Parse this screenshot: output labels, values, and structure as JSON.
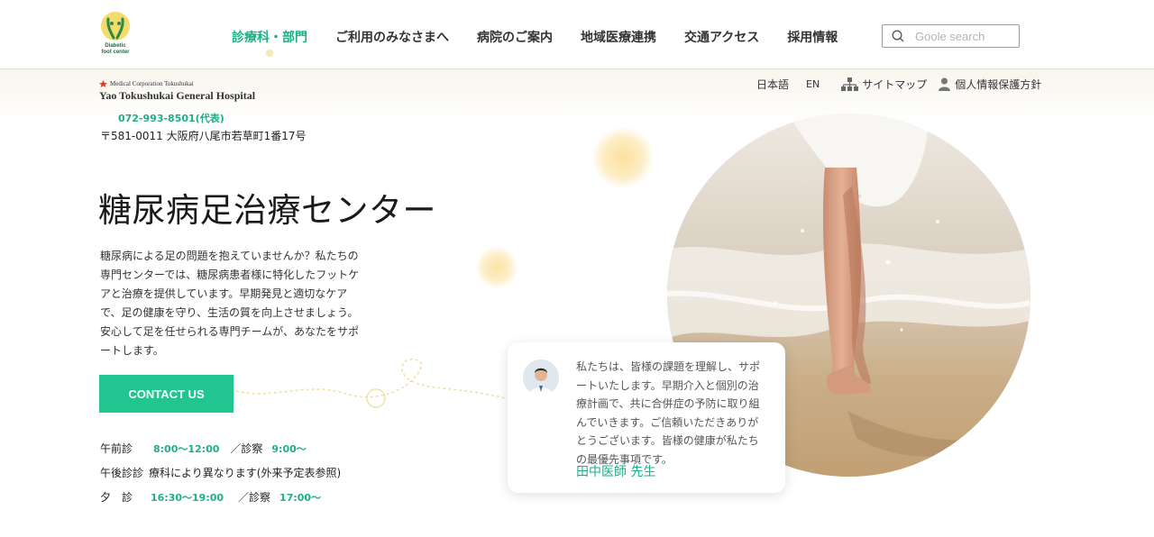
{
  "logo": {
    "text_line1": "Diabetic",
    "text_line2": "foot center"
  },
  "nav": {
    "items": [
      {
        "label": "診療科・部門",
        "active": true
      },
      {
        "label": "ご利用のみなさまへ",
        "active": false
      },
      {
        "label": "病院のご案内",
        "active": false
      },
      {
        "label": "地域医療連携",
        "active": false
      },
      {
        "label": "交通アクセス",
        "active": false
      },
      {
        "label": "採用情報",
        "active": false
      }
    ]
  },
  "search": {
    "placeholder": "Goole search",
    "icon": "search-icon"
  },
  "hospital": {
    "corp": "Medical Corporation Tokushukai",
    "name": "Yao Tokushukai  General Hospital",
    "phone": "072-993-8501(代表)",
    "address": "〒581-0011 大阪府八尾市若草町1番17号"
  },
  "utility": {
    "lang_ja": "日本語",
    "lang_en": "EN",
    "sitemap": "サイトマップ",
    "privacy": "個人情報保護方針"
  },
  "hero": {
    "title": "糖尿病足治療センター",
    "description": "糖尿病による足の問題を抱えていませんか？私たちの専門センターでは、糖尿病患者様に特化したフットケアと治療を提供しています。早期発見と適切なケアで、足の健康を守り、生活の質を向上させましょう。安心して足を任せられる専門チームが、あなたをサポートします。",
    "cta": "CONTACT US"
  },
  "hours": {
    "morning_label": "午前診",
    "morning_time": "8:00〜12:00",
    "morning_sep": "／診察",
    "morning_exam": "9:00〜",
    "afternoon_label": "午後診診",
    "afternoon_text": "療科により異なります(外来予定表参照)",
    "evening_label": "夕　診",
    "evening_time": "16:30〜19:00",
    "evening_sep": "／診察",
    "evening_exam": "17:00〜"
  },
  "card": {
    "message": "私たちは、皆様の課題を理解し、サポートいたします。早期介入と個別の治療計画で、共に合併症の予防に取り組んでいきます。ご信頼いただきありがとうございます。皆様の健康が私たちの最優先事項です。",
    "name": "田中医師 先生"
  },
  "colors": {
    "accent": "#1fae88",
    "button": "#22c58f",
    "glow": "#fbdf96"
  }
}
